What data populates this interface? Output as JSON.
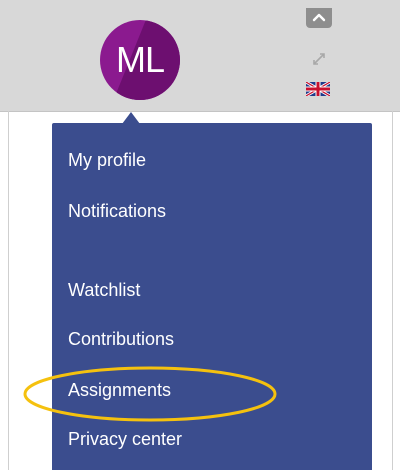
{
  "profile": {
    "initials": "ML",
    "avatar_color": "#8b1a8f"
  },
  "header": {
    "collapse_icon": "chevron-up-icon",
    "expand_icon": "expand-arrows-icon",
    "language_icon": "uk-flag-icon"
  },
  "menu": {
    "background_color": "#3b4d8e",
    "items": [
      {
        "label": "My profile"
      },
      {
        "label": "Notifications"
      },
      {
        "label": "Watchlist"
      },
      {
        "label": "Contributions"
      },
      {
        "label": "Assignments"
      },
      {
        "label": "Privacy center"
      }
    ]
  },
  "annotation": {
    "highlight_color": "#f5c10e",
    "highlighted_item": "Assignments"
  }
}
